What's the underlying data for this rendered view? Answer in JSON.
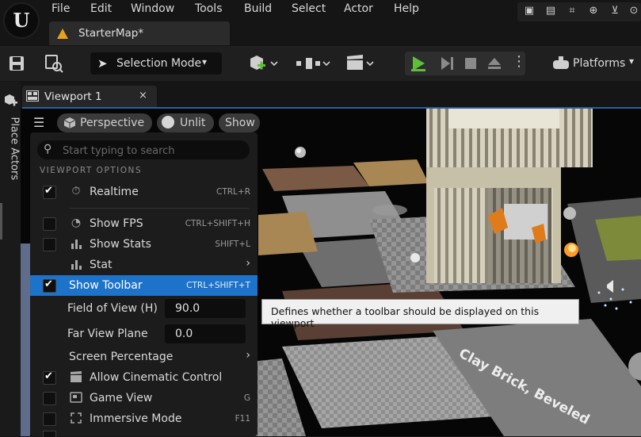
{
  "menu": [
    "File",
    "Edit",
    "Window",
    "Tools",
    "Build",
    "Select",
    "Actor",
    "Help"
  ],
  "map_tab": {
    "label": "StarterMap*"
  },
  "toolbar": {
    "selection_mode": "Selection Mode",
    "platforms": "Platforms"
  },
  "left_panel": {
    "place_actors": "Place Actors"
  },
  "viewport_tab": {
    "label": "Viewport 1",
    "close": "×"
  },
  "viewport_toolbar": {
    "perspective": "Perspective",
    "unlit": "Unlit",
    "show": "Show"
  },
  "dropdown": {
    "search_placeholder": "Start typing to search",
    "section": "VIEWPORT OPTIONS",
    "realtime": {
      "label": "Realtime",
      "shortcut": "CTRL+R",
      "checked": true
    },
    "show_fps": {
      "label": "Show FPS",
      "shortcut": "CTRL+SHIFT+H",
      "checked": false
    },
    "show_stats": {
      "label": "Show Stats",
      "shortcut": "SHIFT+L",
      "checked": false
    },
    "stat": {
      "label": "Stat"
    },
    "show_toolbar": {
      "label": "Show Toolbar",
      "shortcut": "CTRL+SHIFT+T",
      "checked": true
    },
    "fov": {
      "label": "Field of View (H)",
      "value": "90.0"
    },
    "far_plane": {
      "label": "Far View Plane",
      "value": "0.0"
    },
    "screen_percentage": {
      "label": "Screen Percentage"
    },
    "cinematic": {
      "label": "Allow Cinematic Control",
      "checked": true
    },
    "game_view": {
      "label": "Game View",
      "shortcut": "G",
      "checked": false
    },
    "immersive": {
      "label": "Immersive Mode",
      "shortcut": "F11",
      "checked": false
    }
  },
  "tooltip": "Defines whether a toolbar should be displayed on this viewport",
  "scene": {
    "floor_text": "Clay Brick, Beveled"
  },
  "colors": {
    "accent": "#1d72c9",
    "play": "#5fbf3a",
    "map_icon": "#e9a21a"
  }
}
